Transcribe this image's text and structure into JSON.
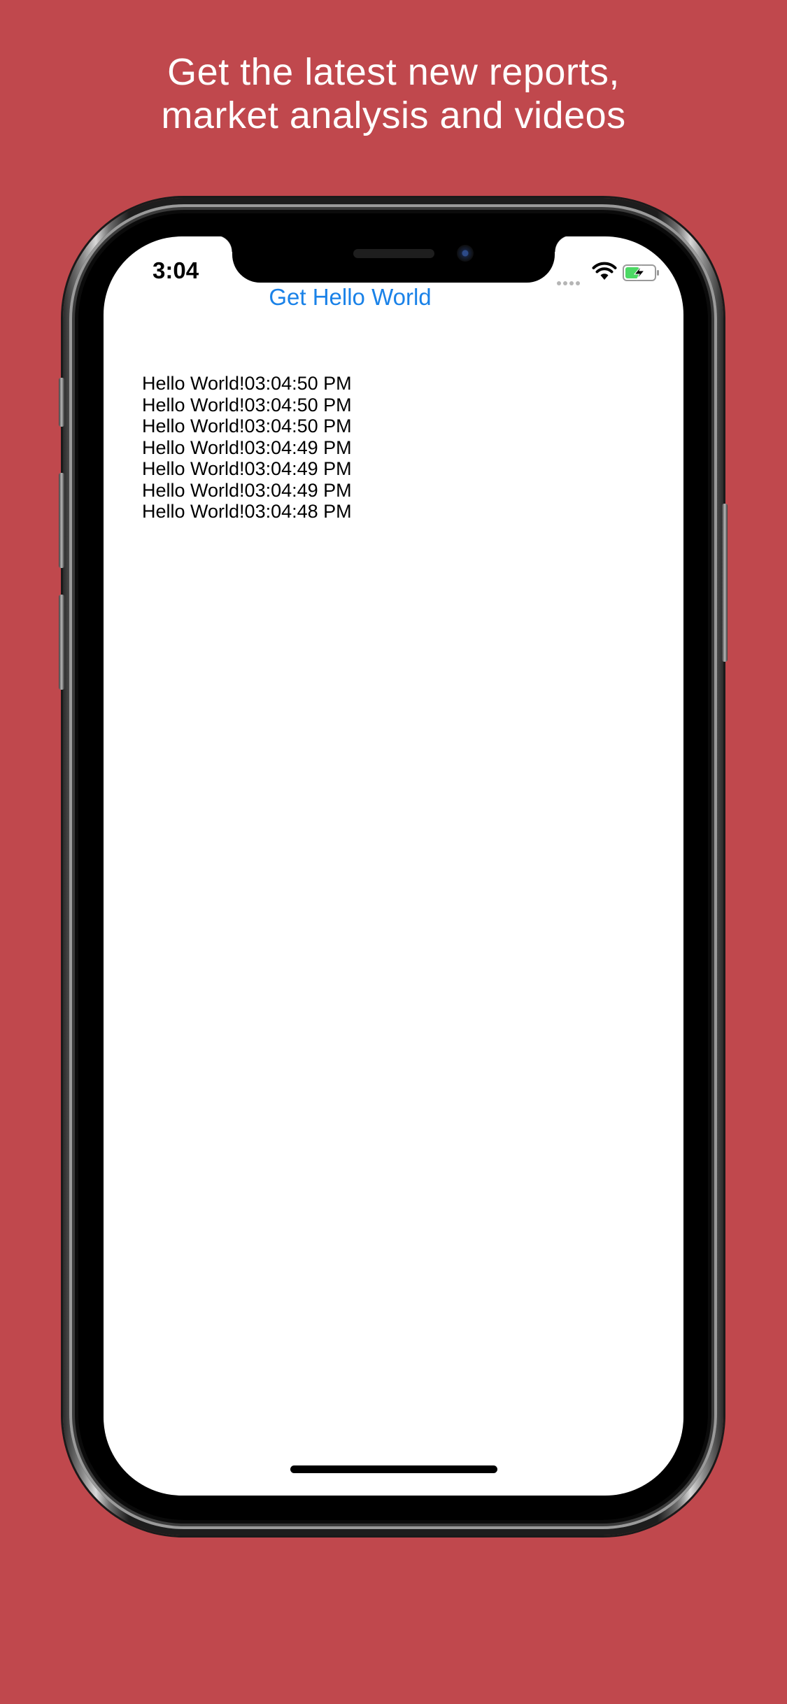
{
  "promo": {
    "headline_line1": "Get the latest new reports,",
    "headline_line2": "market analysis and videos"
  },
  "status_bar": {
    "time": "3:04",
    "icons": [
      "cellular-signal-icon",
      "wifi-icon",
      "battery-charging-icon"
    ]
  },
  "app": {
    "button_label": "Get Hello World",
    "messages": [
      "Hello World!03:04:50 PM",
      "Hello World!03:04:50 PM",
      "Hello World!03:04:50 PM",
      "Hello World!03:04:49 PM",
      "Hello World!03:04:49 PM",
      "Hello World!03:04:49 PM",
      "Hello World!03:04:48 PM"
    ]
  },
  "colors": {
    "background": "#c0484d",
    "link_blue": "#1a82e8",
    "battery_green": "#4cd964"
  }
}
